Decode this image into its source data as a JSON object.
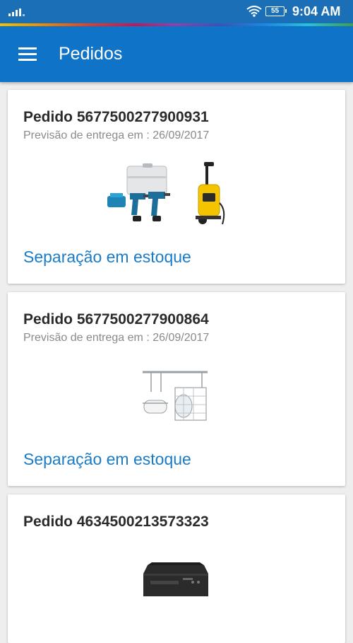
{
  "status_bar": {
    "time": "9:04 AM",
    "battery": "55",
    "icons": [
      "signal-icon",
      "wifi-icon",
      "battery-icon"
    ]
  },
  "app_bar": {
    "title": "Pedidos",
    "menu_icon": "menu-icon"
  },
  "orders": [
    {
      "title": "Pedido 5677500277900931",
      "delivery": "Previsão de entrega em : 26/09/2017",
      "status": "Separação em estoque",
      "products": [
        "drill-kit-image",
        "pressure-washer-image"
      ]
    },
    {
      "title": "Pedido 5677500277900864",
      "delivery": "Previsão de entrega em : 26/09/2017",
      "status": "Separação em estoque",
      "products": [
        "kitchen-rack-image"
      ]
    },
    {
      "title": "Pedido 4634500213573323",
      "products": [
        "printer-image"
      ]
    }
  ],
  "colors": {
    "status_bar": "#1a6fb7",
    "app_bar": "#0f73c8",
    "link": "#1a7cc8",
    "background": "#eeeeee"
  }
}
